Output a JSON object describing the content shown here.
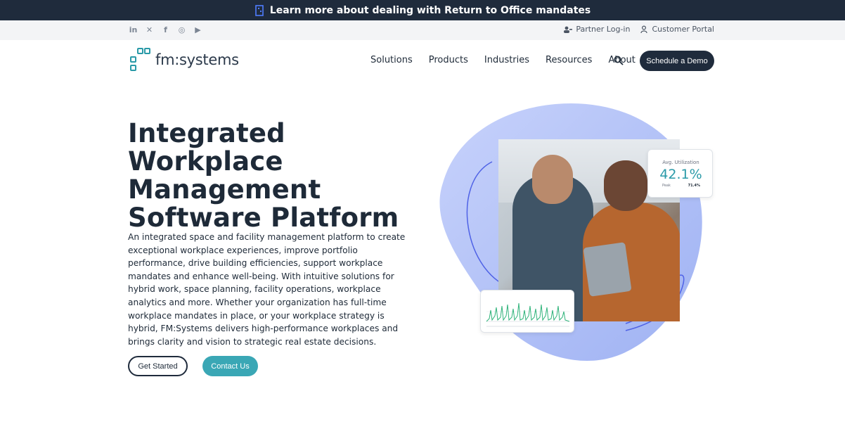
{
  "announcement": {
    "text": "Learn more about dealing with Return to Office mandates",
    "icon": "building-icon"
  },
  "utility": {
    "social": [
      "linkedin-icon",
      "x-icon",
      "facebook-icon",
      "instagram-icon",
      "youtube-icon"
    ],
    "partner_login": "Partner Log-in",
    "customer_portal": "Customer Portal"
  },
  "brand": {
    "name": "fm:systems",
    "accent": "#2a9aa8",
    "dark": "#1f2b3c"
  },
  "nav": {
    "items": [
      "Solutions",
      "Products",
      "Industries",
      "Resources",
      "About"
    ],
    "demo_button": "Schedule a Demo"
  },
  "hero": {
    "title": "Integrated Workplace Management Software Platform",
    "body": "An integrated space and facility management platform to create exceptional workplace experiences, improve portfolio performance, drive building efficiencies, support workplace mandates and enhance well-being. With intuitive solutions for hybrid work, space planning, facility operations, workplace analytics and more. Whether your organization has full-time workplace mandates in place, or your workplace strategy is hybrid, FM:Systems delivers high-performance workplaces and brings clarity and vision to strategic real estate decisions.",
    "primary_button": "Get Started",
    "secondary_button": "Contact Us"
  },
  "utilization_card": {
    "label": "Avg. Utilization",
    "value": "42.1%",
    "peak_label": "Peak",
    "peak_value": "71.4%"
  }
}
